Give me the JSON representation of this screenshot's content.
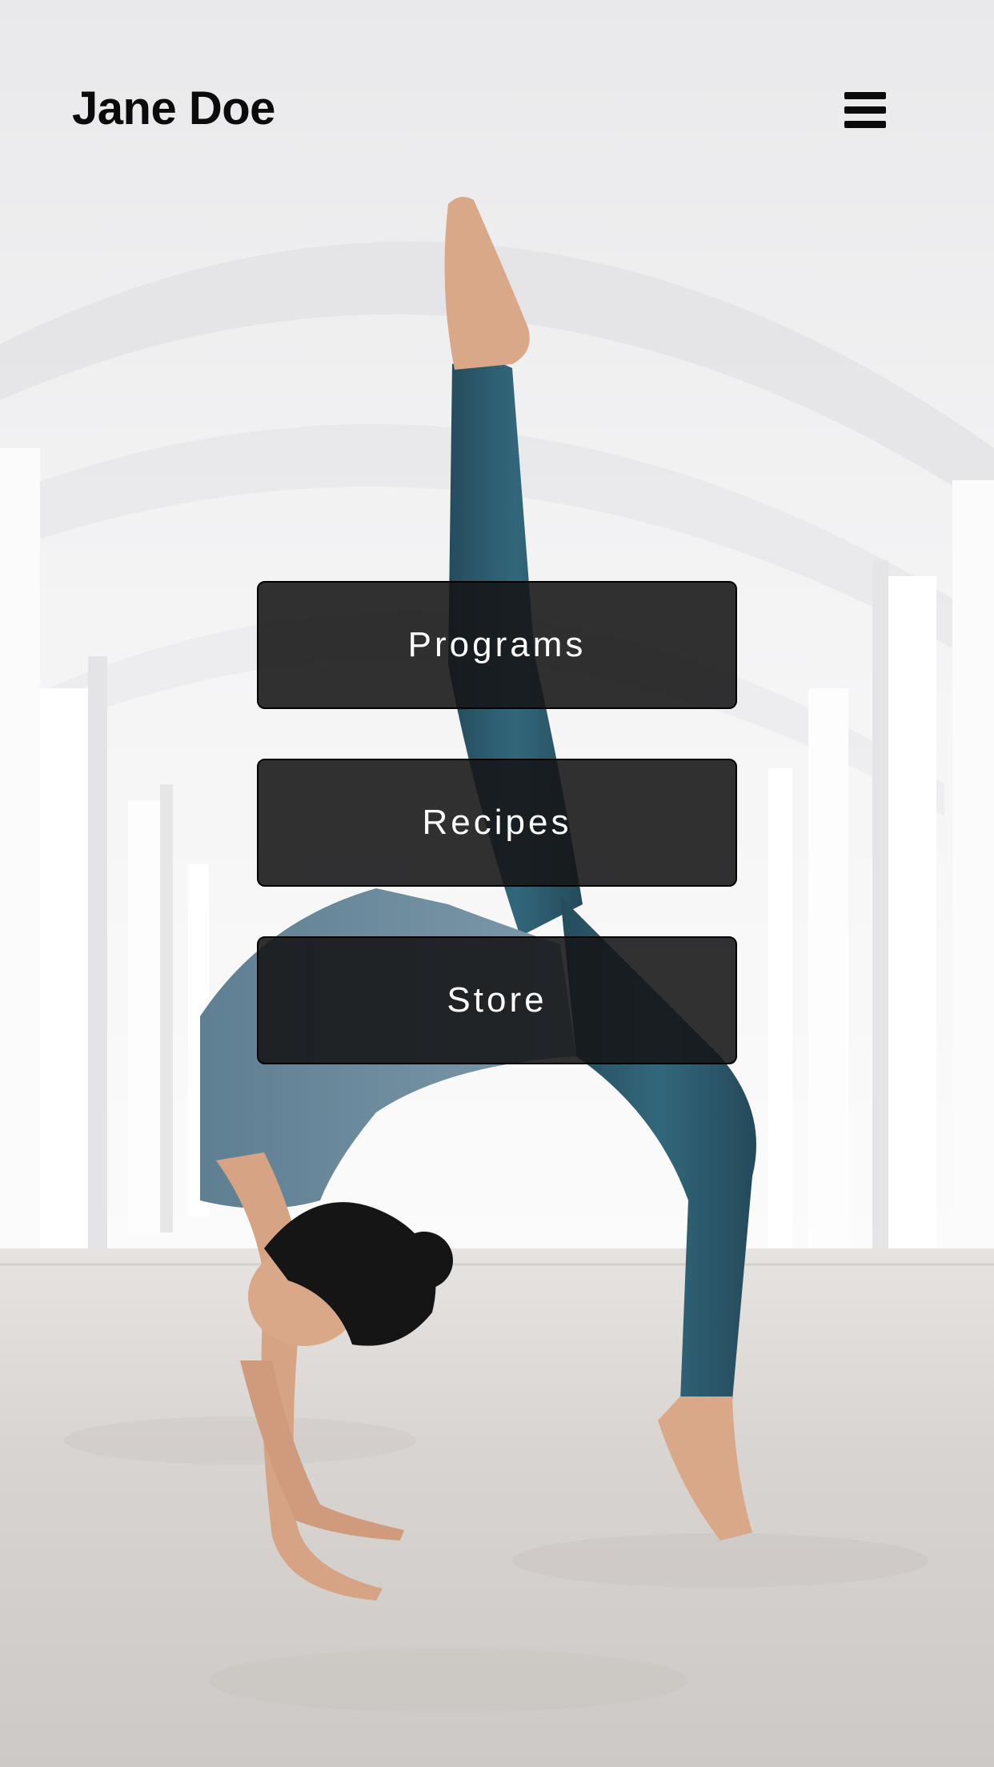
{
  "header": {
    "brand": "Jane Doe",
    "menu_icon": "hamburger-menu-icon"
  },
  "nav": {
    "items": [
      {
        "label": "Programs"
      },
      {
        "label": "Recipes"
      },
      {
        "label": "Store"
      }
    ]
  },
  "colors": {
    "button_bg": "#161618",
    "button_text": "#ffffff",
    "brand_text": "#0b0b0b",
    "wall": "#f1f1f2",
    "floor": "#d6d2cf",
    "leggings": "#2e5c6e",
    "top": "#6f8ea0",
    "skin": "#d9a98a",
    "hair": "#141414"
  }
}
